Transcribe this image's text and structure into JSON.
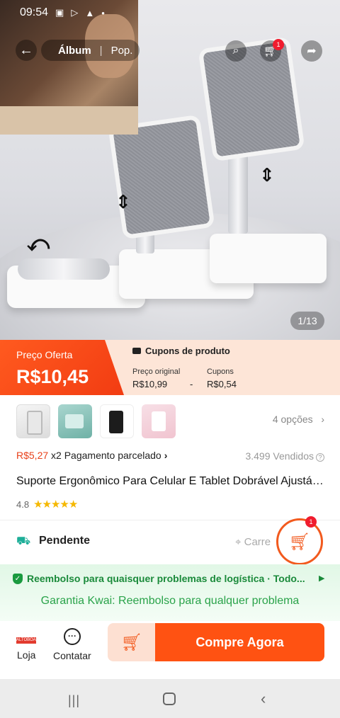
{
  "status_bar": {
    "time": "09:54"
  },
  "header": {
    "tabs": [
      "Álbum",
      "Pop."
    ],
    "cart_badge": "1"
  },
  "gallery": {
    "page_indicator": "1/13"
  },
  "price": {
    "offer_label": "Preço Oferta",
    "offer_value": "R$10,45",
    "coupon_title": "Cupons de produto",
    "original_label": "Preço original",
    "original_value": "R$10,99",
    "minus": "-",
    "coupons_label": "Cupons",
    "coupons_value": "R$0,54"
  },
  "options": {
    "count_label": "4 opções"
  },
  "installment": {
    "amount": "R$5,27",
    "text": " x2 Pagamento parcelado"
  },
  "sold": "3.499 Vendidos",
  "product": {
    "title": "Suporte Ergonômico Para Celular E Tablet Dobrável Ajustável",
    "rating": "4.8",
    "stars": "★★★★★"
  },
  "shipping": {
    "label": "Pendente",
    "location": "Carre"
  },
  "floating_cart": {
    "badge": "1"
  },
  "guarantee": {
    "line1": "Reembolso para quaisquer problemas de logística · Todo...",
    "line2": "Garantia Kwai: Reembolso para qualquer problema"
  },
  "bottom": {
    "shop_logo_text": "ALTOBOAI",
    "shop_label": "Loja",
    "chat_label": "Contatar",
    "buy_label": "Compre Agora"
  },
  "colors": {
    "accent": "#ff5212",
    "green": "#1a8a3a",
    "price_red": "#e8411a"
  }
}
